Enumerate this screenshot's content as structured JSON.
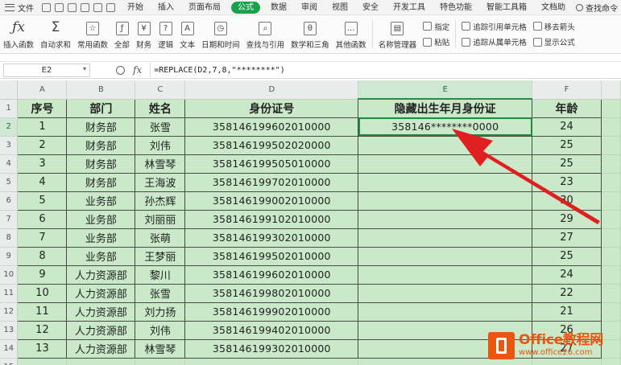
{
  "menubar": {
    "file_label": "文件",
    "tabs": [
      "开始",
      "插入",
      "页面布局",
      "公式",
      "数据",
      "审阅",
      "视图",
      "安全",
      "开发工具",
      "特色功能",
      "智能工具箱",
      "文档助"
    ],
    "active_tab": "公式",
    "search_label": "查找命令"
  },
  "ribbon": {
    "insert_function": "插入函数",
    "autosum": "自动求和",
    "common_functions": "常用函数",
    "all": "全部",
    "financial": "财务",
    "logical": "逻辑",
    "text": "文本",
    "datetime": "日期和时间",
    "lookup": "查找与引用",
    "math": "数学和三角",
    "other": "其他函数",
    "name_manager": "名称管理器",
    "define_name": "指定",
    "paste": "粘贴",
    "trace_precedents": "追踪引用单元格",
    "trace_dependents": "追踪从属单元格",
    "remove_arrows": "移去箭头",
    "show_formulas": "显示公式"
  },
  "formula_bar": {
    "cell_ref": "E2",
    "fx": "fx",
    "formula": "=REPLACE(D2,7,8,\"********\")"
  },
  "grid": {
    "columns": [
      "A",
      "B",
      "C",
      "D",
      "E",
      "F"
    ],
    "selected_column": "E",
    "selected_row": "2",
    "header": [
      "序号",
      "部门",
      "姓名",
      "身份证号",
      "隐藏出生年月身份证",
      "年龄"
    ],
    "rows": [
      [
        "1",
        "财务部",
        "张雪",
        "358146199602010000",
        "358146********0000",
        "24"
      ],
      [
        "2",
        "财务部",
        "刘伟",
        "358146199502020000",
        "",
        "25"
      ],
      [
        "3",
        "财务部",
        "林雪琴",
        "358146199505010000",
        "",
        "25"
      ],
      [
        "4",
        "财务部",
        "王海波",
        "358146199702010000",
        "",
        "23"
      ],
      [
        "5",
        "业务部",
        "孙杰辉",
        "358146199002010000",
        "",
        "30"
      ],
      [
        "6",
        "业务部",
        "刘丽丽",
        "358146199102010000",
        "",
        "29"
      ],
      [
        "7",
        "业务部",
        "张萌",
        "358146199302010000",
        "",
        "27"
      ],
      [
        "8",
        "业务部",
        "王梦丽",
        "358146199502010000",
        "",
        "25"
      ],
      [
        "9",
        "人力资源部",
        "黎川",
        "358146199602010000",
        "",
        "24"
      ],
      [
        "10",
        "人力资源部",
        "张雪",
        "358146199802010000",
        "",
        "22"
      ],
      [
        "11",
        "人力资源部",
        "刘力扬",
        "358146199902010000",
        "",
        "21"
      ],
      [
        "12",
        "人力资源部",
        "刘伟",
        "358146199402010000",
        "",
        "26"
      ],
      [
        "13",
        "人力资源部",
        "林雪琴",
        "358146199302010000",
        "",
        "27"
      ]
    ]
  },
  "watermark": {
    "brand": "Office教程网",
    "url": "www.office26.com"
  },
  "colors": {
    "accent": "#16a34a",
    "sheet_bg": "#c9e9c9",
    "arrow": "#e02020",
    "logo": "#e8560f"
  }
}
